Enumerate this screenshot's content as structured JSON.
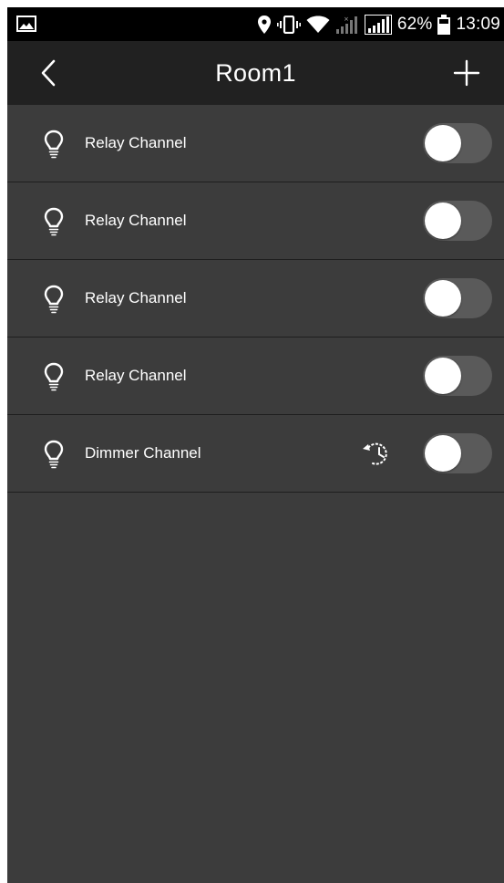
{
  "status_bar": {
    "battery_percent": "62%",
    "time": "13:09",
    "icons": [
      "image-notification-icon",
      "location-icon",
      "vibrate-icon",
      "wifi-icon",
      "signal-icon",
      "signal-icon",
      "battery-icon"
    ]
  },
  "header": {
    "title": "Room1",
    "back_icon": "chevron-left-icon",
    "add_icon": "plus-icon"
  },
  "colors": {
    "status_bar_bg": "#000000",
    "app_bar_bg": "#212121",
    "content_bg": "#3c3c3c",
    "toggle_track_off": "#5a5a5a",
    "toggle_knob": "#ffffff"
  },
  "channels": [
    {
      "label": "Relay Channel",
      "icon": "bulb-icon",
      "on": false,
      "has_schedule": false
    },
    {
      "label": "Relay Channel",
      "icon": "bulb-icon",
      "on": false,
      "has_schedule": false
    },
    {
      "label": "Relay Channel",
      "icon": "bulb-icon",
      "on": false,
      "has_schedule": false
    },
    {
      "label": "Relay Channel",
      "icon": "bulb-icon",
      "on": false,
      "has_schedule": false
    },
    {
      "label": "Dimmer Channel",
      "icon": "bulb-icon",
      "on": false,
      "has_schedule": true,
      "schedule_icon": "timer-schedule-icon"
    }
  ]
}
